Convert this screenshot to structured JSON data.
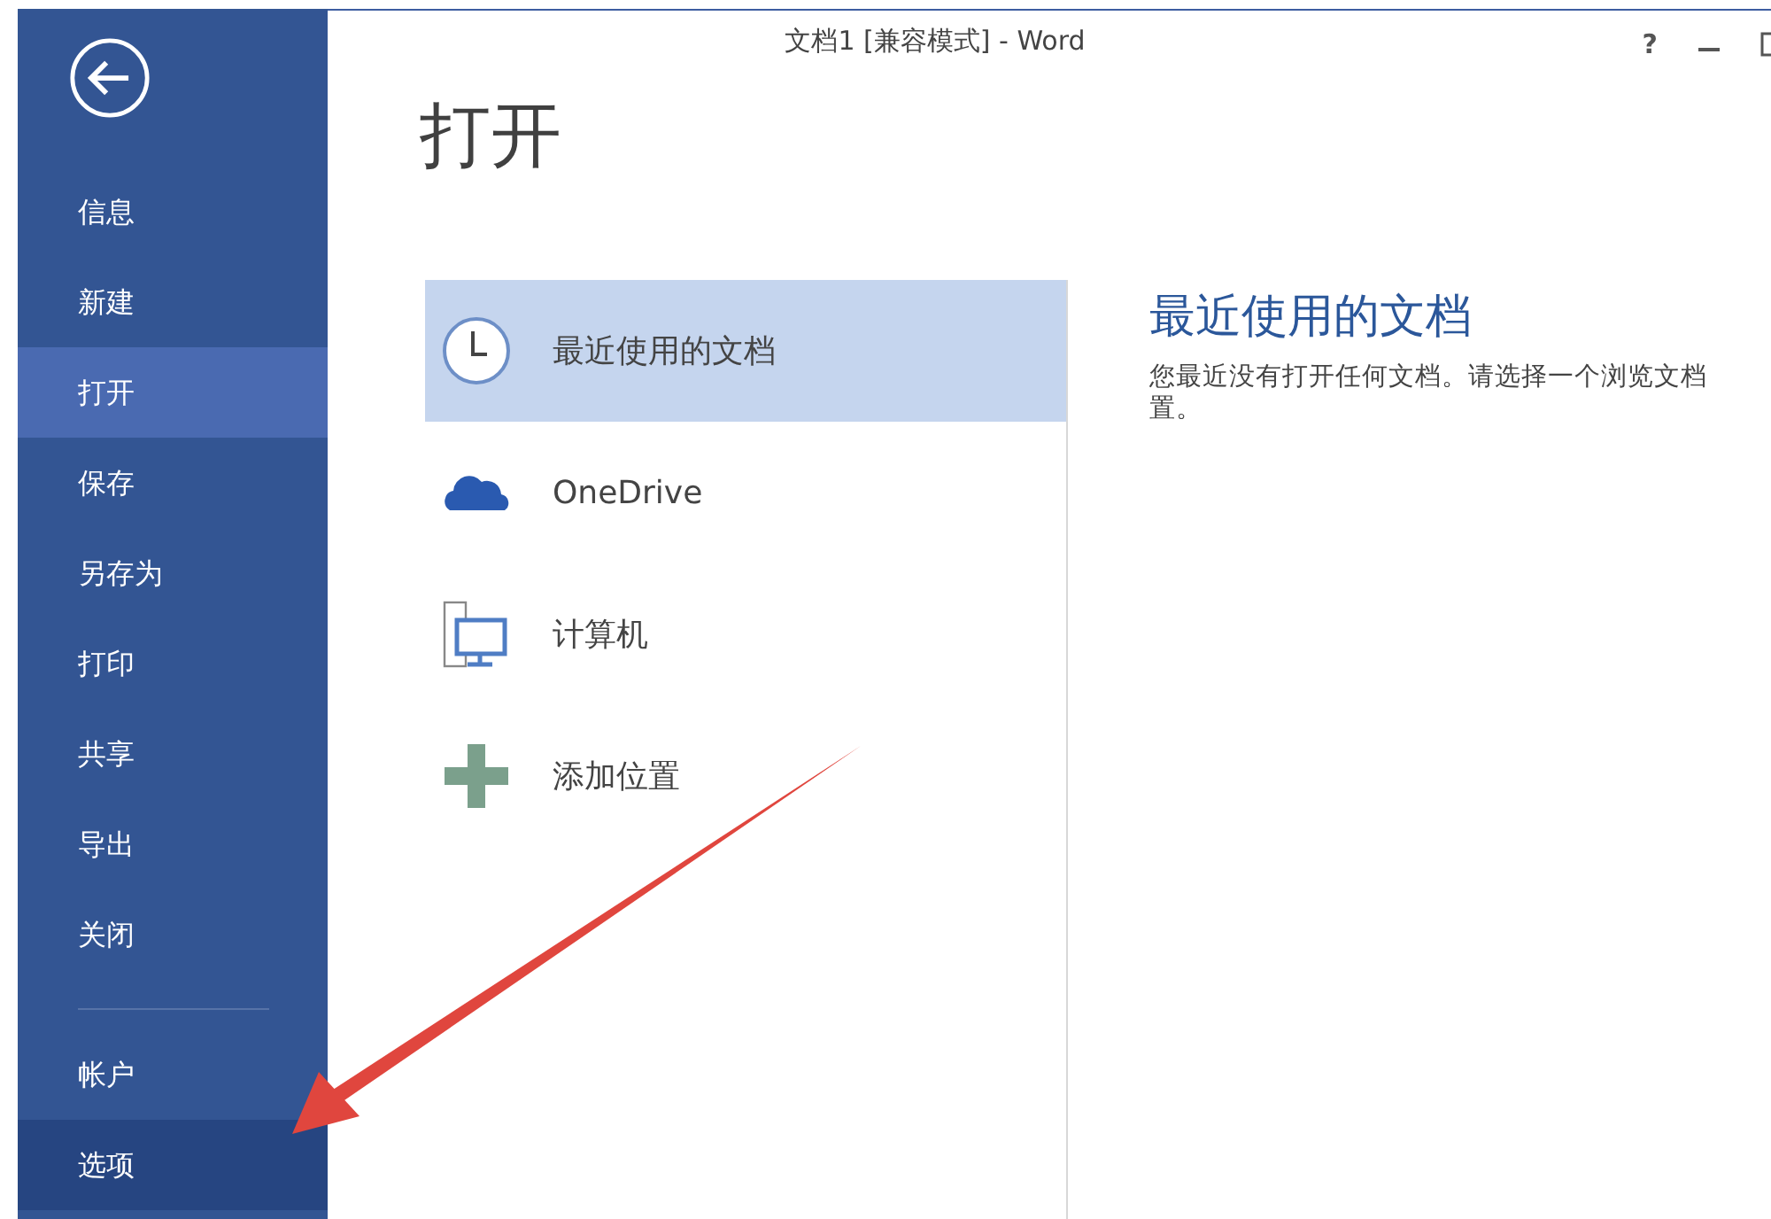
{
  "window": {
    "title": "文档1 [兼容模式] - Word",
    "controls": [
      {
        "kind": "help",
        "label": "?"
      },
      {
        "kind": "minimize"
      },
      {
        "kind": "maximize"
      }
    ]
  },
  "sidebar": {
    "items": [
      {
        "label": "信息",
        "selected": false,
        "highlighted": false
      },
      {
        "label": "新建",
        "selected": false,
        "highlighted": false
      },
      {
        "label": "打开",
        "selected": true,
        "highlighted": false
      },
      {
        "label": "保存",
        "selected": false,
        "highlighted": false
      },
      {
        "label": "另存为",
        "selected": false,
        "highlighted": false
      },
      {
        "label": "打印",
        "selected": false,
        "highlighted": false
      },
      {
        "label": "共享",
        "selected": false,
        "highlighted": false
      },
      {
        "label": "导出",
        "selected": false,
        "highlighted": false
      },
      {
        "label": "关闭",
        "selected": false,
        "highlighted": false
      }
    ],
    "bottom_items": [
      {
        "label": "帐户",
        "selected": false,
        "highlighted": false
      },
      {
        "label": "选项",
        "selected": false,
        "highlighted": true
      }
    ]
  },
  "page_title": "打开",
  "places": [
    {
      "kind": "clock",
      "label": "最近使用的文档",
      "selected": true
    },
    {
      "kind": "cloud",
      "label": "OneDrive",
      "selected": false
    },
    {
      "kind": "computer",
      "label": "计算机",
      "selected": false
    },
    {
      "kind": "add",
      "label": "添加位置",
      "selected": false
    }
  ],
  "detail": {
    "heading": "最近使用的文档",
    "description_lines": [
      "您最近没有打开任何文档。请选择一个浏览文档",
      "置。"
    ]
  },
  "annotation": {
    "kind": "arrow"
  }
}
